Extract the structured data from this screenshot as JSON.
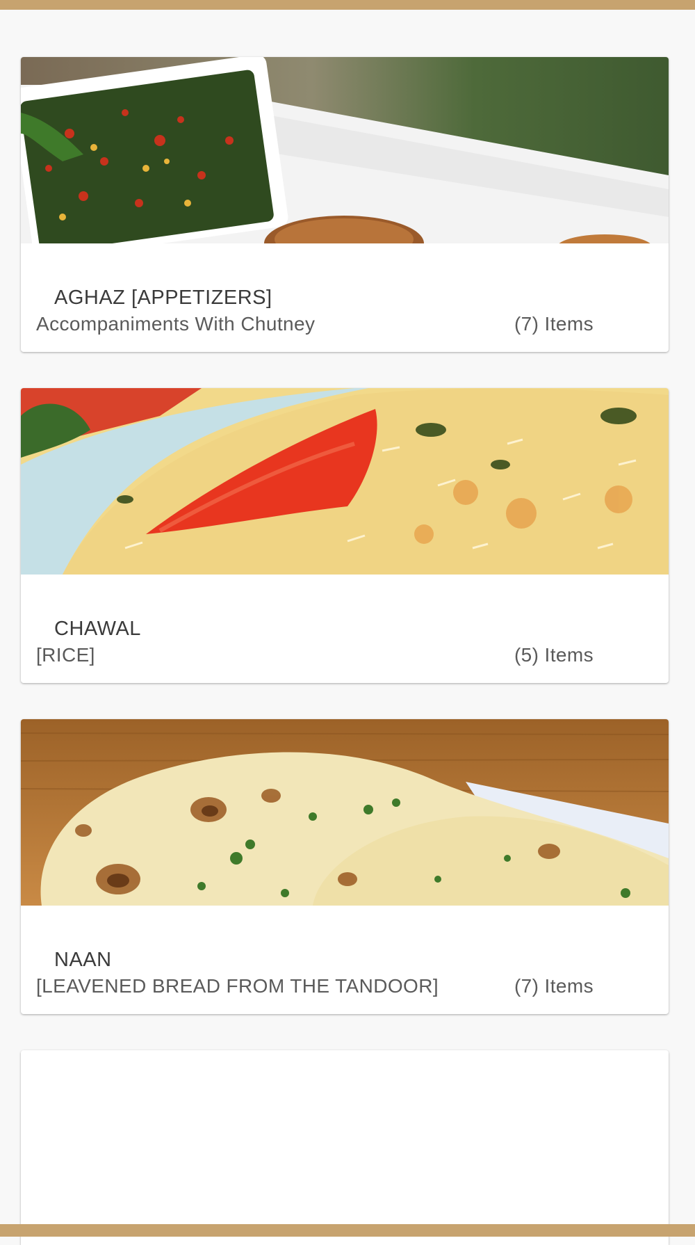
{
  "categories": [
    {
      "title": "AGHAZ [APPETIZERS]",
      "subtitle": "Accompaniments With Chutney",
      "count": "(7) Items",
      "image": "appetizer-chutney-photo"
    },
    {
      "title": "CHAWAL",
      "subtitle": "[RICE]",
      "count": "(5) Items",
      "image": "biryani-rice-photo"
    },
    {
      "title": "NAAN",
      "subtitle": "[LEAVENED BREAD FROM THE TANDOOR]",
      "count": "(7) Items",
      "image": "naan-bread-photo"
    }
  ],
  "colors": {
    "brand_bar": "#c7a36f",
    "background": "#f8f8f8",
    "card": "#ffffff"
  }
}
